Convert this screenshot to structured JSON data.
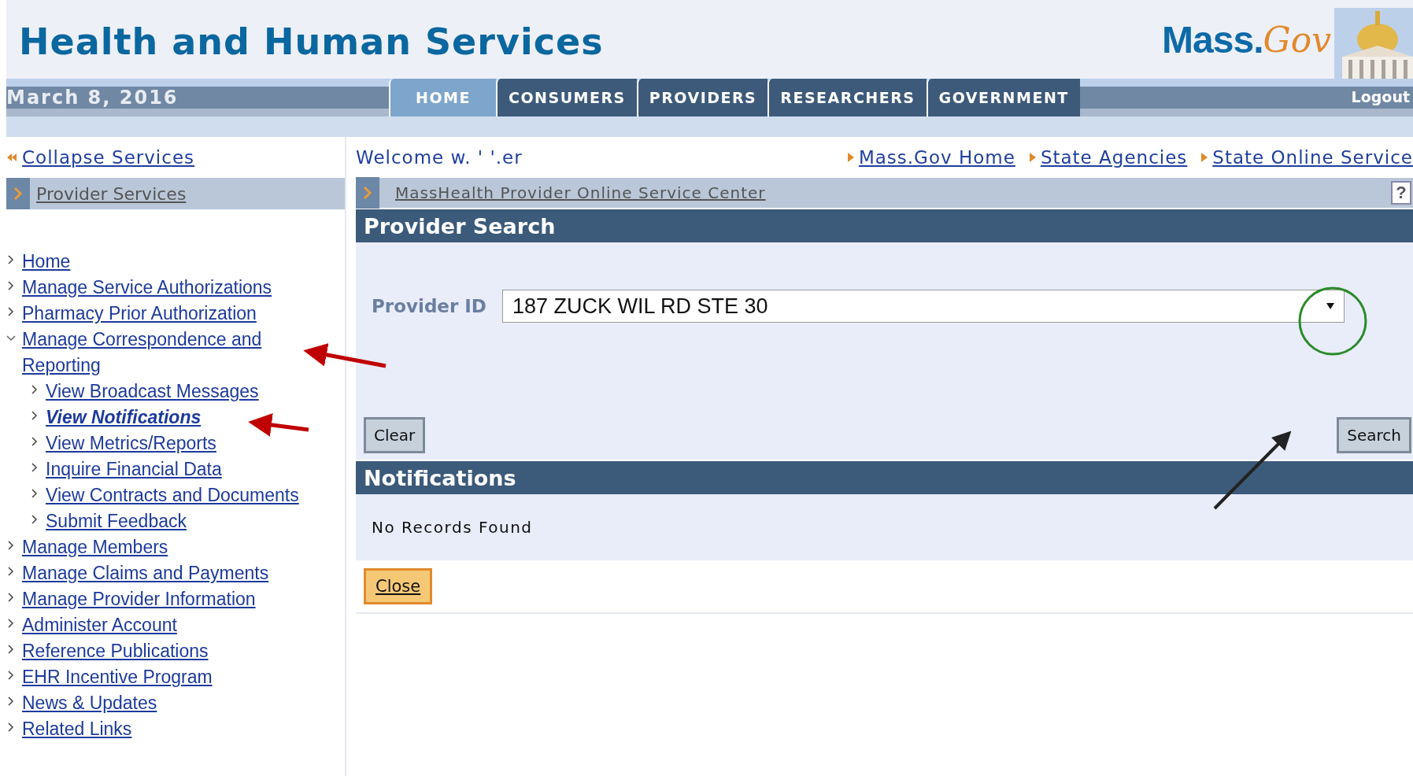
{
  "header": {
    "title": "Health and Human Services",
    "logo": {
      "part_1": "Mass.",
      "part_2": "Gov"
    }
  },
  "nav": {
    "date": "March 8, 2016",
    "tabs": [
      {
        "label": "HOME",
        "selected": true
      },
      {
        "label": "CONSUMERS",
        "selected": false
      },
      {
        "label": "PROVIDERS",
        "selected": false
      },
      {
        "label": "RESEARCHERS",
        "selected": false
      },
      {
        "label": "GOVERNMENT",
        "selected": false
      }
    ],
    "logout": "Logout"
  },
  "collapse_link": "Collapse Services",
  "welcome": "Welcome w. ' '.er",
  "top_links": [
    "Mass.Gov Home",
    "State Agencies",
    "State Online Service"
  ],
  "sidebar": {
    "title": "Provider Services",
    "items": [
      {
        "label": "Home",
        "expanded": false,
        "selected": false
      },
      {
        "label": "Manage Service Authorizations",
        "expanded": false,
        "selected": false
      },
      {
        "label": "Pharmacy Prior Authorization",
        "expanded": false,
        "selected": false
      },
      {
        "label": "Manage Correspondence and Reporting",
        "expanded": true,
        "selected": false,
        "children": [
          {
            "label": "View Broadcast Messages",
            "selected": false
          },
          {
            "label": "View Notifications",
            "selected": true
          },
          {
            "label": "View Metrics/Reports",
            "selected": false
          },
          {
            "label": "Inquire Financial Data",
            "selected": false
          },
          {
            "label": "View Contracts and Documents",
            "selected": false
          },
          {
            "label": "Submit Feedback",
            "selected": false
          }
        ]
      },
      {
        "label": "Manage Members",
        "expanded": false,
        "selected": false
      },
      {
        "label": "Manage Claims and Payments",
        "expanded": false,
        "selected": false
      },
      {
        "label": "Manage Provider Information",
        "expanded": false,
        "selected": false
      },
      {
        "label": "Administer Account",
        "expanded": false,
        "selected": false
      },
      {
        "label": "Reference Publications",
        "expanded": false,
        "selected": false
      },
      {
        "label": "EHR Incentive Program",
        "expanded": false,
        "selected": false
      },
      {
        "label": "News & Updates",
        "expanded": false,
        "selected": false
      },
      {
        "label": "Related Links",
        "expanded": false,
        "selected": false
      }
    ]
  },
  "breadcrumb": "MassHealth Provider Online Service Center",
  "help": "?",
  "search_panel": {
    "title": "Provider Search",
    "field_label": "Provider ID",
    "value": "187 ZUCK WIL RD STE 30",
    "clear": "Clear",
    "search": "Search"
  },
  "notifications": {
    "title": "Notifications",
    "message": "No Records Found",
    "close": "Close"
  }
}
